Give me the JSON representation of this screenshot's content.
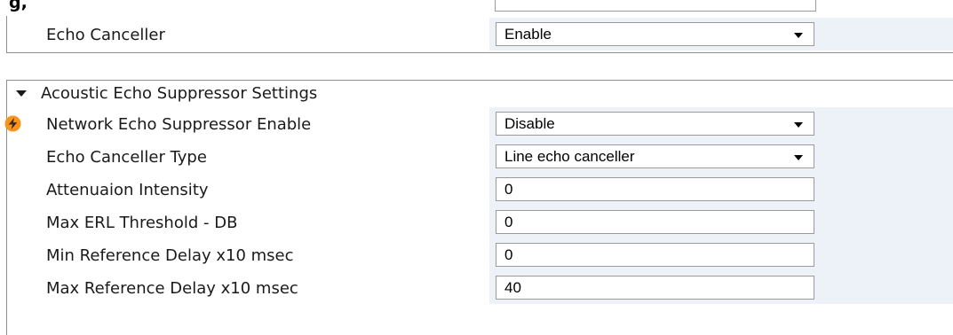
{
  "top_partial": {
    "title_fragment": "g,"
  },
  "echo_canceller": {
    "label": "Echo Canceller",
    "value": "Enable"
  },
  "section": {
    "title": "Acoustic Echo Suppressor Settings",
    "rows": [
      {
        "label": "Network Echo Suppressor Enable",
        "value": "Disable",
        "type": "select",
        "icon": "lightning-icon"
      },
      {
        "label": "Echo Canceller Type",
        "value": "Line echo canceller",
        "type": "select"
      },
      {
        "label": "Attenuaion Intensity",
        "value": "0",
        "type": "text"
      },
      {
        "label": "Max ERL Threshold - DB",
        "value": "0",
        "type": "text"
      },
      {
        "label": "Min Reference Delay x10 msec",
        "value": "0",
        "type": "text"
      },
      {
        "label": "Max Reference Delay x10 msec",
        "value": "40",
        "type": "text"
      }
    ]
  },
  "colors": {
    "value_cell_bg": "#edf2f8",
    "border": "#8f8f8f",
    "bolt_icon": "#f7941d"
  }
}
